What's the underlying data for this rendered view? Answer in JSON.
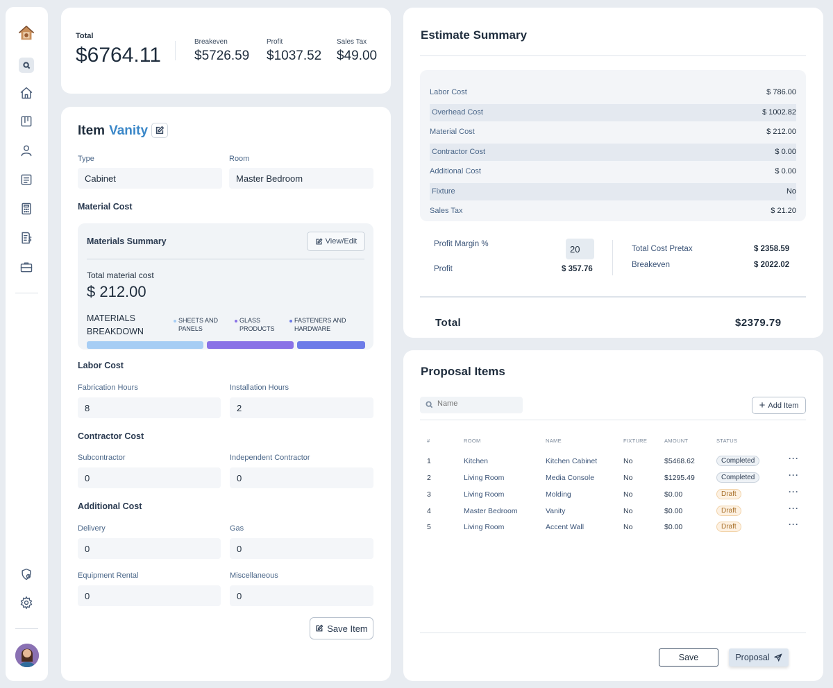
{
  "totals": {
    "total_label": "Total",
    "total_value": "$6764.11",
    "breakeven_label": "Breakeven",
    "breakeven_value": "$5726.59",
    "profit_label": "Profit",
    "profit_value": "$1037.52",
    "sales_tax_label": "Sales Tax",
    "sales_tax_value": "$49.00"
  },
  "item": {
    "title_prefix": "Item",
    "name": "Vanity",
    "type_label": "Type",
    "type_value": "Cabinet",
    "room_label": "Room",
    "room_value": "Master Bedroom",
    "material_cost_title": "Material Cost",
    "materials": {
      "title": "Materials Summary",
      "view_edit_label": "View/Edit",
      "total_label": "Total material cost",
      "total_value": "$ 212.00",
      "breakdown_label": "MATERIALS BREAKDOWN",
      "categories": [
        {
          "label": "SHEETS AND PANELS",
          "color": "#a6cdf4",
          "share": 0.43
        },
        {
          "label": "GLASS PRODUCTS",
          "color": "#8a72e6",
          "share": 0.32
        },
        {
          "label": "FASTENERS AND HARDWARE",
          "color": "#6d7ce8",
          "share": 0.25
        }
      ]
    },
    "labor_title": "Labor Cost",
    "fabrication_label": "Fabrication Hours",
    "fabrication_value": "8",
    "installation_label": "Installation Hours",
    "installation_value": "2",
    "contractor_title": "Contractor Cost",
    "subcontractor_label": "Subcontractor",
    "subcontractor_value": "0",
    "independent_label": "Independent Contractor",
    "independent_value": "0",
    "additional_title": "Additional Cost",
    "delivery_label": "Delivery",
    "delivery_value": "0",
    "gas_label": "Gas",
    "gas_value": "0",
    "equipment_label": "Equipment Rental",
    "equipment_value": "0",
    "misc_label": "Miscellaneous",
    "misc_value": "0",
    "save_label": "Save Item"
  },
  "estimate": {
    "title": "Estimate Summary",
    "rows": [
      {
        "label": "Labor Cost",
        "value": "$ 786.00"
      },
      {
        "label": "Overhead Cost",
        "value": "$ 1002.82"
      },
      {
        "label": "Material Cost",
        "value": "$ 212.00"
      },
      {
        "label": "Contractor Cost",
        "value": "$ 0.00"
      },
      {
        "label": "Additional Cost",
        "value": "$ 0.00"
      },
      {
        "label": "Fixture",
        "value": "No"
      },
      {
        "label": "Sales Tax",
        "value": "$ 21.20"
      }
    ],
    "profit_margin_label": "Profit Margin %",
    "profit_margin_value": "20",
    "profit_label": "Profit",
    "profit_value": "$ 357.76",
    "total_cost_pretax_label": "Total Cost Pretax",
    "total_cost_pretax_value": "$ 2358.59",
    "breakeven_label": "Breakeven",
    "breakeven_value": "$ 2022.02",
    "total_label": "Total",
    "total_value": "$2379.79"
  },
  "proposal": {
    "title": "Proposal Items",
    "search_placeholder": "Name",
    "add_item_label": "Add Item",
    "columns": [
      "#",
      "ROOM",
      "NAME",
      "FIXTURE",
      "AMOUNT",
      "STATUS"
    ],
    "rows": [
      {
        "num": "1",
        "room": "Kitchen",
        "name": "Kitchen Cabinet",
        "fixture": "No",
        "amount": "$5468.62",
        "status": "Completed"
      },
      {
        "num": "2",
        "room": "Living Room",
        "name": "Media Console",
        "fixture": "No",
        "amount": "$1295.49",
        "status": "Completed"
      },
      {
        "num": "3",
        "room": "Living Room",
        "name": "Molding",
        "fixture": "No",
        "amount": "$0.00",
        "status": "Draft"
      },
      {
        "num": "4",
        "room": "Master Bedroom",
        "name": "Vanity",
        "fixture": "No",
        "amount": "$0.00",
        "status": "Draft"
      },
      {
        "num": "5",
        "room": "Living Room",
        "name": "Accent Wall",
        "fixture": "No",
        "amount": "$0.00",
        "status": "Draft"
      }
    ],
    "more_glyph": "···",
    "save_label": "Save",
    "proposal_label": "Proposal"
  },
  "icons": {
    "logo": "house-logo-icon",
    "nav": [
      "home-icon",
      "board-icon",
      "user-icon",
      "document-icon",
      "calculator-icon",
      "invoice-icon",
      "briefcase-icon"
    ],
    "bottom": [
      "shield-icon",
      "gear-icon"
    ]
  },
  "colors": {
    "accent": "#3a87c8",
    "draft_badge": "#a8702a",
    "background": "#e8ecf1"
  }
}
